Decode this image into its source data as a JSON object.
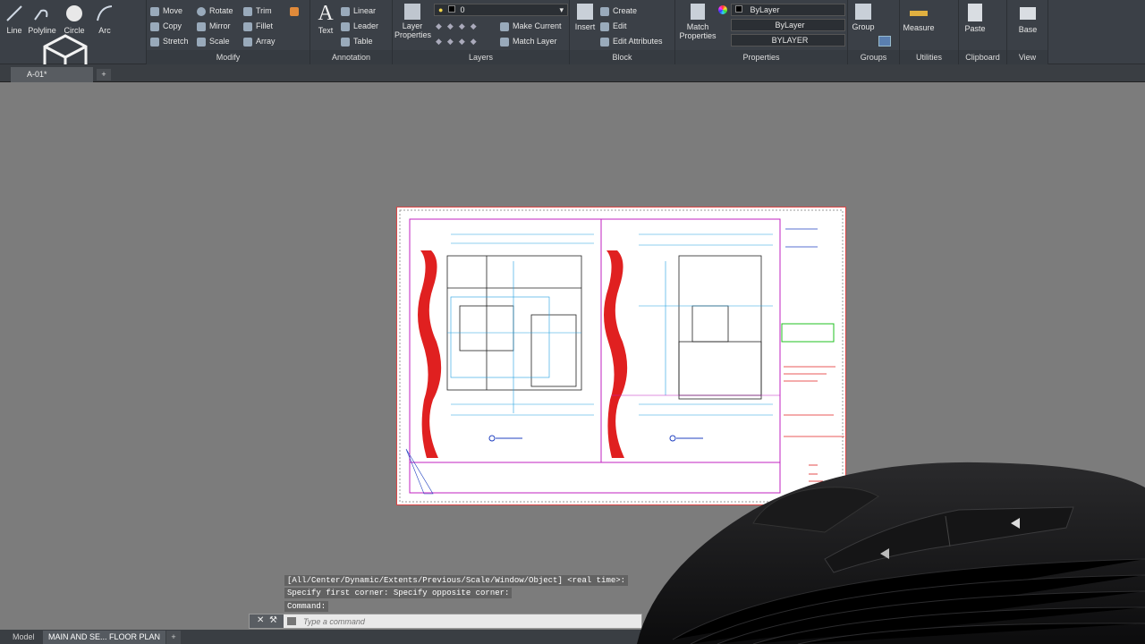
{
  "ribbon": {
    "draw": [
      {
        "label": "Line",
        "icon": "line-icon"
      },
      {
        "label": "Polyline",
        "icon": "polyline-icon"
      },
      {
        "label": "Circle",
        "icon": "circle-icon"
      },
      {
        "label": "Arc",
        "icon": "arc-icon"
      }
    ],
    "modify": {
      "title": "Modify",
      "items": [
        "Move",
        "Rotate",
        "Trim",
        "Copy",
        "Mirror",
        "Fillet",
        "Stretch",
        "Scale",
        "Array"
      ]
    },
    "annotation": {
      "title": "Annotation",
      "text_label": "Text",
      "items": [
        "Linear",
        "Leader",
        "Table"
      ]
    },
    "layers": {
      "title": "Layers",
      "layer_properties": "Layer Properties",
      "current_layer": "0",
      "make_current": "Make Current",
      "match_layer": "Match Layer"
    },
    "block": {
      "title": "Block",
      "insert": "Insert",
      "create": "Create",
      "edit": "Edit",
      "edit_attributes": "Edit Attributes"
    },
    "properties": {
      "title": "Properties",
      "match_properties": "Match Properties",
      "color": "ByLayer",
      "linetype": "ByLayer",
      "lineweight": "BYLAYER"
    },
    "groups": {
      "title": "Groups",
      "group": "Group"
    },
    "utilities": {
      "title": "Utilities",
      "measure": "Measure"
    },
    "clipboard": {
      "title": "Clipboard",
      "paste": "Paste"
    },
    "view": {
      "title": "View",
      "base": "Base"
    }
  },
  "doc_tab": {
    "label": "A-01*"
  },
  "command": {
    "history": [
      "[All/Center/Dynamic/Extents/Previous/Scale/Window/Object] <real time>:",
      "Specify first corner:  Specify opposite corner:",
      "Command:"
    ],
    "placeholder": "Type a command"
  },
  "layout_tabs": [
    "Model",
    "MAIN AND SE... FLOOR PLAN"
  ],
  "colors": {
    "accent_red": "#e02020",
    "ribbon_bg": "#3b4047",
    "canvas_bg": "#7c7c7c"
  }
}
